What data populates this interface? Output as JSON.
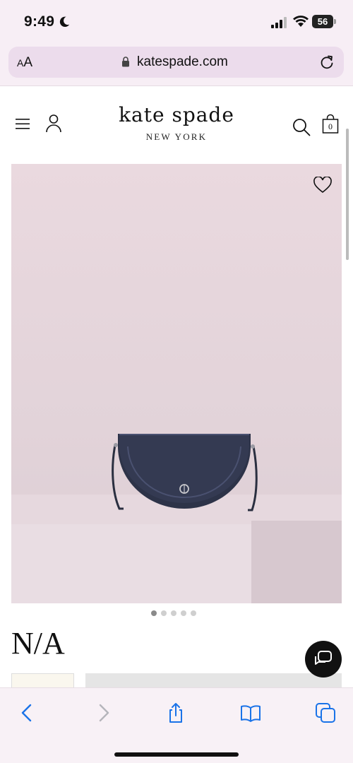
{
  "status_bar": {
    "time": "9:49",
    "battery": "56"
  },
  "browser": {
    "aa_small": "A",
    "aa_large": "A",
    "url": "katespade.com"
  },
  "header": {
    "brand_name": "kate spade",
    "brand_sub": "NEW YORK",
    "bag_count": "0"
  },
  "product": {
    "title": "N/A",
    "image_slides": 5,
    "active_slide": 1
  },
  "colors": {
    "status_bg": "#f7eef5",
    "url_pill": "#ecdcec",
    "safari_blue": "#1a73e8",
    "bag_navy": "#2d3348",
    "background_pink": "#e6d7dd"
  },
  "icons": {
    "menu": "menu-icon",
    "account": "account-icon",
    "search": "search-icon",
    "bag": "shopping-bag-icon",
    "favorite": "heart-icon",
    "chat": "chat-icon",
    "back": "chevron-left-icon",
    "forward": "chevron-right-icon",
    "share": "share-icon",
    "bookmarks": "book-icon",
    "tabs": "tabs-icon"
  }
}
